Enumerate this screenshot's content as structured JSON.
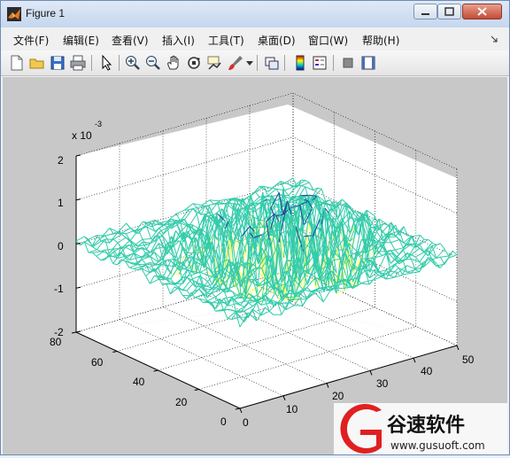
{
  "window": {
    "title": "Figure 1"
  },
  "menu": [
    {
      "label": "文件(F)"
    },
    {
      "label": "编辑(E)"
    },
    {
      "label": "查看(V)"
    },
    {
      "label": "插入(I)"
    },
    {
      "label": "工具(T)"
    },
    {
      "label": "桌面(D)"
    },
    {
      "label": "窗口(W)"
    },
    {
      "label": "帮助(H)"
    }
  ],
  "toolbar_icons": [
    "new-figure-icon",
    "open-icon",
    "save-icon",
    "print-icon",
    "pointer-icon",
    "zoom-in-icon",
    "zoom-out-icon",
    "pan-icon",
    "rotate-3d-icon",
    "data-cursor-icon",
    "brush-icon",
    "brush-dropdown-icon",
    "link-plot-icon",
    "colorbar-icon",
    "legend-icon",
    "hide-plot-tools-icon",
    "show-plot-tools-icon"
  ],
  "plot": {
    "exponent_label": "x 10",
    "exponent_power": "-3",
    "z_ticks": [
      "2",
      "1",
      "0",
      "-1",
      "-2"
    ],
    "y_ticks": [
      "80",
      "60",
      "40",
      "20",
      "0"
    ],
    "x_ticks": [
      "0",
      "10",
      "20",
      "30",
      "40",
      "50"
    ],
    "colors": {
      "mesh_low": "#ffff66",
      "mesh_mid": "#33ccaa",
      "mesh_high": "#1d3fa0",
      "background": "#ffffff",
      "figure_bg": "#c8c8c8"
    }
  },
  "watermark": {
    "brand": "谷速软件",
    "url": "www.gusuoft.com",
    "logo_color": "#e02020"
  }
}
